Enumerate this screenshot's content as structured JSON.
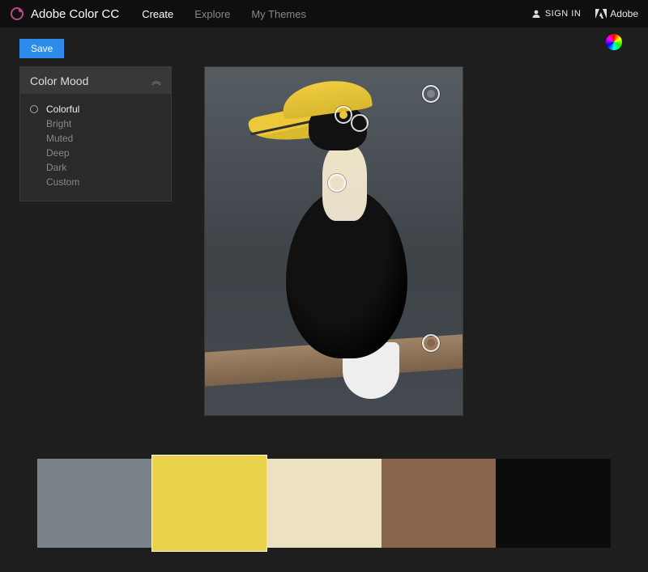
{
  "header": {
    "app_title": "Adobe Color CC",
    "nav": [
      {
        "label": "Create",
        "active": true
      },
      {
        "label": "Explore",
        "active": false
      },
      {
        "label": "My Themes",
        "active": false
      }
    ],
    "signin_label": "SIGN IN",
    "brand_label": "Adobe"
  },
  "actions": {
    "save_label": "Save"
  },
  "mood_panel": {
    "title": "Color Mood",
    "items": [
      {
        "label": "Colorful",
        "selected": true
      },
      {
        "label": "Bright",
        "selected": false
      },
      {
        "label": "Muted",
        "selected": false
      },
      {
        "label": "Deep",
        "selected": false
      },
      {
        "label": "Dark",
        "selected": false
      },
      {
        "label": "Custom",
        "selected": false
      }
    ]
  },
  "palette": {
    "swatches": [
      {
        "hex": "#7a828a",
        "active": false
      },
      {
        "hex": "#ebd24b",
        "active": true
      },
      {
        "hex": "#ece1c0",
        "active": false
      },
      {
        "hex": "#8a654d",
        "active": false
      },
      {
        "hex": "#0c0c0c",
        "active": false
      }
    ]
  }
}
